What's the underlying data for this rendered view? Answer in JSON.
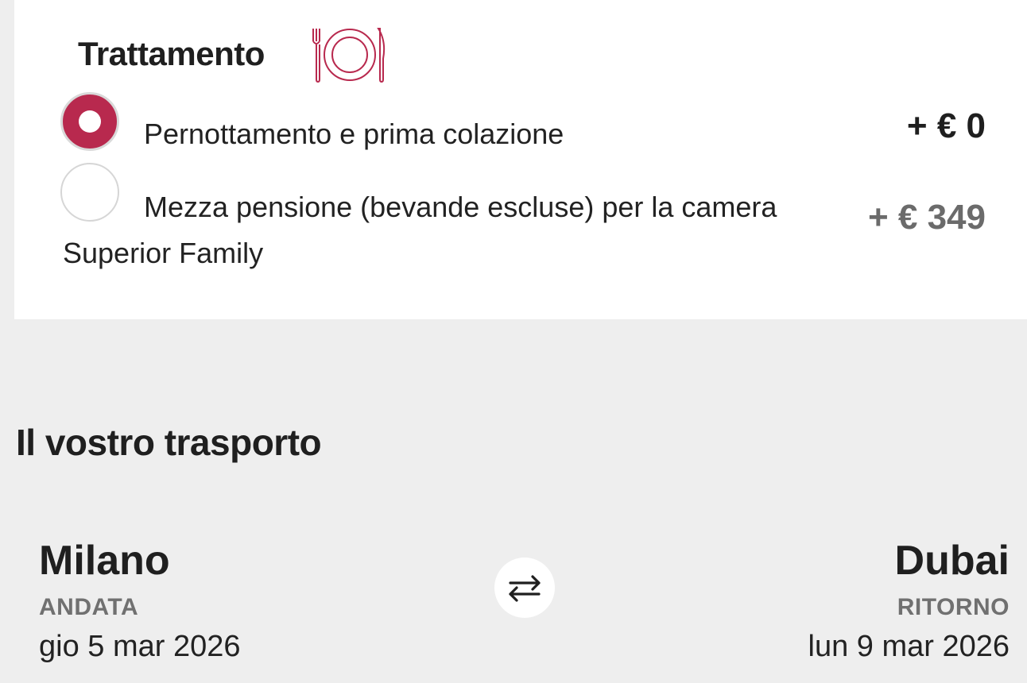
{
  "meal": {
    "title": "Trattamento",
    "icon": "plate-cutlery-icon",
    "accent_color": "#b8294e",
    "options": [
      {
        "label": "Pernottamento e prima colazione",
        "price": "+ € 0",
        "selected": true
      },
      {
        "label_line1": "Mezza pensione (bevande escluse) per la camera",
        "label_line2": "Superior Family",
        "price": "+ € 349",
        "selected": false
      }
    ]
  },
  "transport": {
    "title": "Il vostro trasporto",
    "origin": {
      "city": "Milano",
      "direction": "ANDATA",
      "date": "gio 5 mar 2026"
    },
    "destination": {
      "city": "Dubai",
      "direction": "RITORNO",
      "date": "lun 9 mar 2026"
    },
    "swap_icon": "swap-arrows-icon"
  }
}
